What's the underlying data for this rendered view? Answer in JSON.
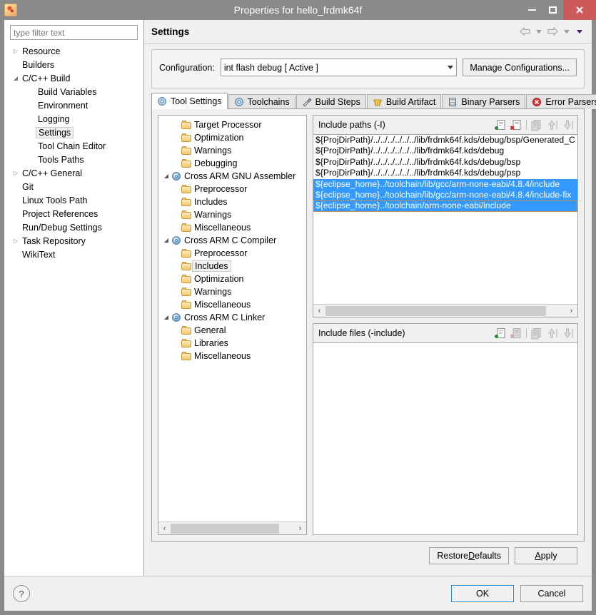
{
  "window": {
    "title": "Properties for hello_frdmk64f",
    "icon": "app-icon",
    "minimize_label": "–",
    "maximize_label": "□",
    "close_label": "✕"
  },
  "filter": {
    "placeholder": "type filter text",
    "value": ""
  },
  "nav_tree": {
    "items": [
      {
        "label": "Resource",
        "indent": 0,
        "twisty": "collapsed",
        "selected": false
      },
      {
        "label": "Builders",
        "indent": 0,
        "twisty": "none",
        "selected": false
      },
      {
        "label": "C/C++ Build",
        "indent": 0,
        "twisty": "expanded",
        "selected": false
      },
      {
        "label": "Build Variables",
        "indent": 1,
        "twisty": "none",
        "selected": false
      },
      {
        "label": "Environment",
        "indent": 1,
        "twisty": "none",
        "selected": false
      },
      {
        "label": "Logging",
        "indent": 1,
        "twisty": "none",
        "selected": false
      },
      {
        "label": "Settings",
        "indent": 1,
        "twisty": "none",
        "selected": true
      },
      {
        "label": "Tool Chain Editor",
        "indent": 1,
        "twisty": "none",
        "selected": false
      },
      {
        "label": "Tools Paths",
        "indent": 1,
        "twisty": "none",
        "selected": false
      },
      {
        "label": "C/C++ General",
        "indent": 0,
        "twisty": "collapsed",
        "selected": false
      },
      {
        "label": "Git",
        "indent": 0,
        "twisty": "none",
        "selected": false
      },
      {
        "label": "Linux Tools Path",
        "indent": 0,
        "twisty": "none",
        "selected": false
      },
      {
        "label": "Project References",
        "indent": 0,
        "twisty": "none",
        "selected": false
      },
      {
        "label": "Run/Debug Settings",
        "indent": 0,
        "twisty": "none",
        "selected": false
      },
      {
        "label": "Task Repository",
        "indent": 0,
        "twisty": "collapsed",
        "selected": false
      },
      {
        "label": "WikiText",
        "indent": 0,
        "twisty": "none",
        "selected": false
      }
    ]
  },
  "header": {
    "title": "Settings",
    "nav": {
      "back_icon": "back-arrow-icon",
      "back_menu_icon": "chevron-down-icon",
      "forward_icon": "forward-arrow-icon",
      "forward_menu_icon": "chevron-down-icon",
      "view_menu_icon": "chevron-down-icon"
    }
  },
  "configuration": {
    "label": "Configuration:",
    "value": "int flash debug  [ Active ]",
    "manage_button": "Manage Configurations...",
    "dropdown_icon": "chevron-down-icon"
  },
  "tabs": [
    {
      "label": "Tool Settings",
      "icon": "tool-settings-icon",
      "active": true
    },
    {
      "label": "Toolchains",
      "icon": "toolchains-icon",
      "active": false
    },
    {
      "label": "Build Steps",
      "icon": "build-steps-icon",
      "active": false
    },
    {
      "label": "Build Artifact",
      "icon": "build-artifact-icon",
      "active": false
    },
    {
      "label": "Binary Parsers",
      "icon": "binary-parsers-icon",
      "active": false
    },
    {
      "label": "Error Parsers",
      "icon": "error-parsers-icon",
      "active": false
    }
  ],
  "tool_tree": {
    "items": [
      {
        "label": "Target Processor",
        "indent": 1,
        "icon": "folder",
        "twisty": "none",
        "selected": false
      },
      {
        "label": "Optimization",
        "indent": 1,
        "icon": "folder",
        "twisty": "none",
        "selected": false
      },
      {
        "label": "Warnings",
        "indent": 1,
        "icon": "folder",
        "twisty": "none",
        "selected": false
      },
      {
        "label": "Debugging",
        "indent": 1,
        "icon": "folder",
        "twisty": "none",
        "selected": false
      },
      {
        "label": "Cross ARM GNU Assembler",
        "indent": 0,
        "icon": "gear",
        "twisty": "expanded",
        "selected": false
      },
      {
        "label": "Preprocessor",
        "indent": 1,
        "icon": "folder",
        "twisty": "none",
        "selected": false
      },
      {
        "label": "Includes",
        "indent": 1,
        "icon": "folder",
        "twisty": "none",
        "selected": false
      },
      {
        "label": "Warnings",
        "indent": 1,
        "icon": "folder",
        "twisty": "none",
        "selected": false
      },
      {
        "label": "Miscellaneous",
        "indent": 1,
        "icon": "folder",
        "twisty": "none",
        "selected": false
      },
      {
        "label": "Cross ARM C Compiler",
        "indent": 0,
        "icon": "gear",
        "twisty": "expanded",
        "selected": false
      },
      {
        "label": "Preprocessor",
        "indent": 1,
        "icon": "folder",
        "twisty": "none",
        "selected": false
      },
      {
        "label": "Includes",
        "indent": 1,
        "icon": "folder",
        "twisty": "none",
        "selected": true
      },
      {
        "label": "Optimization",
        "indent": 1,
        "icon": "folder",
        "twisty": "none",
        "selected": false
      },
      {
        "label": "Warnings",
        "indent": 1,
        "icon": "folder",
        "twisty": "none",
        "selected": false
      },
      {
        "label": "Miscellaneous",
        "indent": 1,
        "icon": "folder",
        "twisty": "none",
        "selected": false
      },
      {
        "label": "Cross ARM C Linker",
        "indent": 0,
        "icon": "gear",
        "twisty": "expanded",
        "selected": false
      },
      {
        "label": "General",
        "indent": 1,
        "icon": "folder",
        "twisty": "none",
        "selected": false
      },
      {
        "label": "Libraries",
        "indent": 1,
        "icon": "folder",
        "twisty": "none",
        "selected": false
      },
      {
        "label": "Miscellaneous",
        "indent": 1,
        "icon": "folder",
        "twisty": "none",
        "selected": false
      }
    ]
  },
  "include_paths": {
    "title": "Include paths (-I)",
    "tools": [
      {
        "name": "add-include-path-icon",
        "state": "enabled"
      },
      {
        "name": "delete-include-path-icon",
        "state": "enabled"
      },
      {
        "name": "edit-include-path-icon",
        "state": "disabled"
      },
      {
        "name": "move-up-icon",
        "state": "disabled"
      },
      {
        "name": "move-down-icon",
        "state": "disabled"
      }
    ],
    "rows": [
      {
        "text": "${ProjDirPath}/../../../../../../lib/frdmk64f.kds/debug/bsp/Generated_C",
        "selected": false,
        "focused": false
      },
      {
        "text": "${ProjDirPath}/../../../../../../lib/frdmk64f.kds/debug",
        "selected": false,
        "focused": false
      },
      {
        "text": "${ProjDirPath}/../../../../../../lib/frdmk64f.kds/debug/bsp",
        "selected": false,
        "focused": false
      },
      {
        "text": "${ProjDirPath}/../../../../../../lib/frdmk64f.kds/debug/psp",
        "selected": false,
        "focused": false
      },
      {
        "text": "${eclipse_home}../toolchain/lib/gcc/arm-none-eabi/4.8.4/include",
        "selected": true,
        "focused": false
      },
      {
        "text": "${eclipse_home}../toolchain/lib/gcc/arm-none-eabi/4.8.4/include-fix",
        "selected": true,
        "focused": false
      },
      {
        "text": "${eclipse_home}../toolchain/arm-none-eabi/include",
        "selected": true,
        "focused": true
      }
    ],
    "scroll": {
      "left_arrow": "‹",
      "right_arrow": "›",
      "thumb_percent": 92
    }
  },
  "include_files": {
    "title": "Include files (-include)",
    "tools": [
      {
        "name": "add-include-file-icon",
        "state": "enabled"
      },
      {
        "name": "delete-include-file-icon",
        "state": "disabled"
      },
      {
        "name": "edit-include-file-icon",
        "state": "disabled"
      },
      {
        "name": "move-up-icon",
        "state": "disabled"
      },
      {
        "name": "move-down-icon",
        "state": "disabled"
      }
    ],
    "rows": []
  },
  "tool_tree_scroll": {
    "left_arrow": "‹",
    "right_arrow": "›",
    "thumb_percent": 88
  },
  "apply_row": {
    "restore_defaults": {
      "pre": "Restore ",
      "accel": "D",
      "post": "efaults"
    },
    "apply": {
      "pre": "",
      "accel": "A",
      "post": "pply"
    }
  },
  "footer": {
    "help_icon": "help-icon",
    "help_glyph": "?",
    "ok": "OK",
    "cancel": "Cancel"
  },
  "colors": {
    "selection_blue": "#3399ff",
    "titlebar_gray": "#8a8a8a",
    "close_red": "#cd5a5a",
    "panel_gray": "#f0f0f0",
    "default_button_border": "#2a8ad4"
  }
}
